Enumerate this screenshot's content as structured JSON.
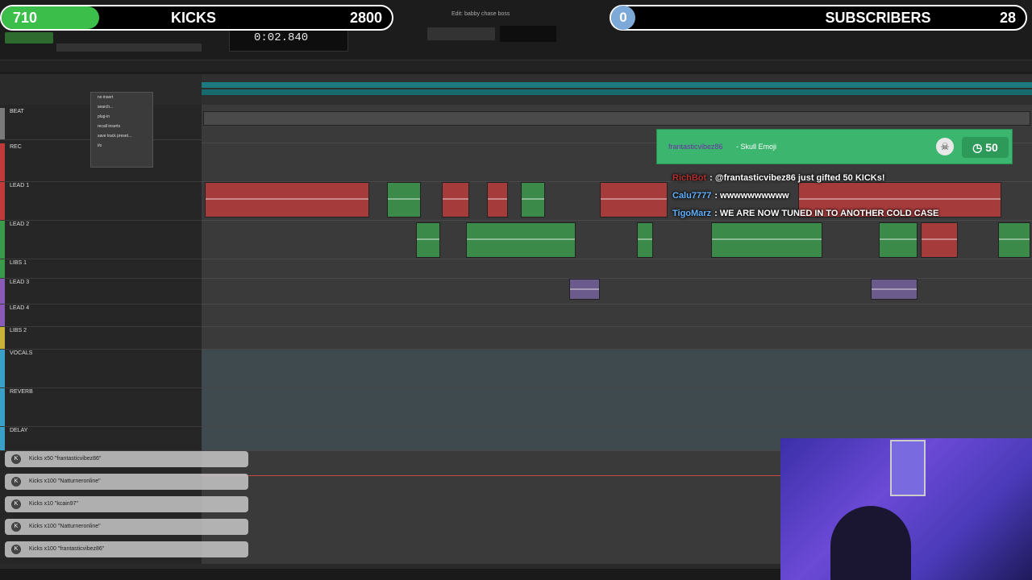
{
  "overlay": {
    "kicks": {
      "count": "710",
      "label": "KICKS",
      "goal": "2800",
      "progress": 0.25
    },
    "subs": {
      "count": "0",
      "label": "SUBSCRIBERS",
      "goal": "28"
    }
  },
  "daw": {
    "window_title": "Edit: babby chase boss",
    "counter": "0:02.840",
    "tracks": [
      "BEAT",
      "REC",
      "LEAD 1",
      "LEAD 2",
      "LIBS 1",
      "LEAD 3",
      "LEAD 4",
      "LIBS 2",
      "VOCALS",
      "REVERB",
      "DELAY"
    ],
    "insert_menu": [
      "no insert",
      "search...",
      "plug-in",
      "recall inserts",
      "save track preset...",
      "i/o"
    ]
  },
  "notification": {
    "user": "frantasticvibez86",
    "text": "- Skull Emoji",
    "amount": "50"
  },
  "chat": [
    {
      "user": "RichBot",
      "text": ": @frantasticvibez86 just gifted 50 KICKs!"
    },
    {
      "user": "Calu7777",
      "text": ": wwwwwwwwww"
    },
    {
      "user": "TigoMarz",
      "text": ": WE ARE NOW TUNED IN TO ANOTHER COLD CASE"
    }
  ],
  "kicks_feed": [
    "Kicks x50 \"frantasticvibez86\"",
    "Kicks x100 \"Natturneronline\"",
    "Kicks x10 \"kcain97\"",
    "Kicks x100 \"Natturneronline\"",
    "Kicks x100 \"frantasticvibez86\""
  ],
  "colors": {
    "kicks_fill": "#3cbf4a",
    "notification": "#3cb56e",
    "accent_user": "#6b2fa7"
  }
}
